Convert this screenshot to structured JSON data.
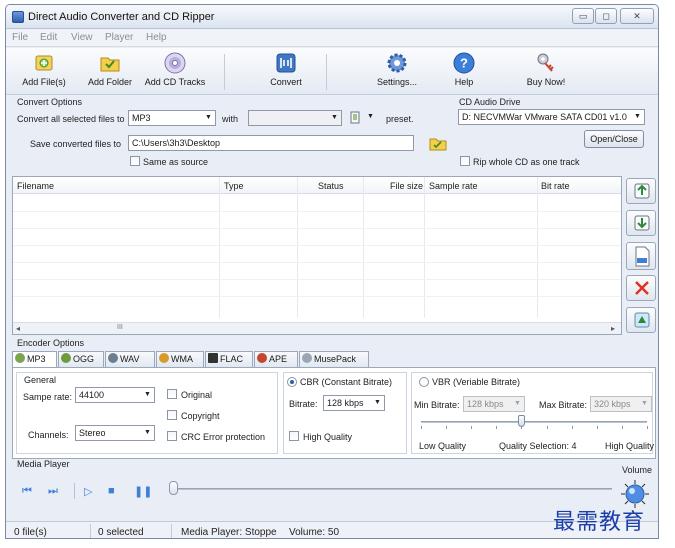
{
  "window": {
    "title": "Direct Audio Converter and CD Ripper",
    "minimize": "▭",
    "maximize": "◻",
    "close": "✕"
  },
  "menu": [
    "File",
    "Edit",
    "View",
    "Player",
    "Help"
  ],
  "toolbar": {
    "add_files": "Add File(s)",
    "add_folder": "Add Folder",
    "add_cd_tracks": "Add CD Tracks",
    "convert": "Convert",
    "settings": "Settings...",
    "help": "Help",
    "buy_now": "Buy Now!"
  },
  "convert_options": {
    "group": "Convert Options",
    "convert_all_label": "Convert all selected files to",
    "format_value": "MP3",
    "with_label": "with",
    "preset_value": "",
    "preset_label": "preset.",
    "save_label": "Save converted files to",
    "save_path": "C:\\Users\\3h3\\Desktop",
    "same_as_source": "Same as source"
  },
  "cd_drive": {
    "group": "CD Audio Drive",
    "drive_value": "D: NECVMWar VMware SATA CD01 v1.0",
    "open_close": "Open/Close",
    "rip_whole": "Rip whole CD as one track"
  },
  "file_list": {
    "columns": [
      "Filename",
      "Type",
      "Status",
      "File size",
      "Sample rate",
      "Bit rate"
    ],
    "scroll_left": "◂",
    "scroll_thumb": "III",
    "scroll_right": "▸"
  },
  "encoder": {
    "group": "Encoder Options",
    "tabs": [
      "MP3",
      "OGG",
      "WAV",
      "WMA",
      "FLAC",
      "APE",
      "MusePack"
    ],
    "general_label": "General",
    "sample_rate_label": "Sampe rate:",
    "sample_rate_value": "44100",
    "channels_label": "Channels:",
    "channels_value": "Stereo",
    "original": "Original",
    "copyright": "Copyright",
    "crc": "CRC Error protection",
    "cbr_label": "CBR (Constant Bitrate)",
    "bitrate_label": "Bitrate:",
    "bitrate_value": "128 kbps",
    "high_quality": "High Quality",
    "vbr_label": "VBR (Veriable Bitrate)",
    "min_bitrate_label": "Min Bitrate:",
    "min_bitrate_value": "128 kbps",
    "max_bitrate_label": "Max Bitrate:",
    "max_bitrate_value": "320 kbps",
    "low_quality": "Low Quality",
    "quality_selection": "Quality Selection: 4",
    "high_quality_end": "High Quality",
    "quality_level": 4
  },
  "media_player": {
    "group": "Media Player",
    "volume_label": "Volume",
    "prev": "⏮",
    "next": "⏭",
    "play": "▷",
    "stop": "■",
    "pause": "❚❚"
  },
  "status": {
    "files": "0 file(s)",
    "selected": "0 selected",
    "player": "Media Player: Stoppe",
    "volume": "Volume: 50"
  },
  "watermark": "最需教育",
  "colors": {
    "accent": "#2d5ea8",
    "window_bg": "#e9eef6",
    "watermark": "#1c3ea8"
  }
}
